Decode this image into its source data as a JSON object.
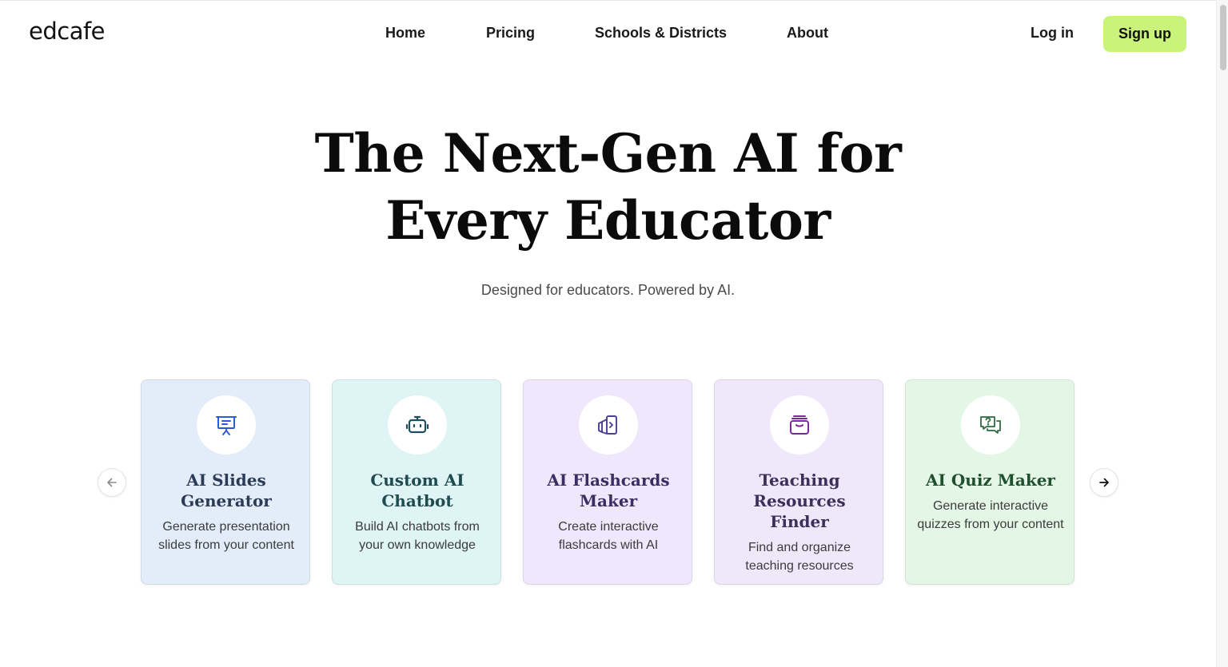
{
  "brand": {
    "logo_text": "edcafe"
  },
  "nav": {
    "items": [
      {
        "label": "Home"
      },
      {
        "label": "Pricing"
      },
      {
        "label": "Schools & Districts"
      },
      {
        "label": "About"
      }
    ],
    "login_label": "Log in",
    "signup_label": "Sign up"
  },
  "hero": {
    "title_line1": "The Next-Gen AI for",
    "title_line2": "Every Educator",
    "subtitle": "Designed for educators. Powered by AI."
  },
  "carousel": {
    "prev_icon": "arrow-left-icon",
    "next_icon": "arrow-right-icon",
    "cards": [
      {
        "title": "AI Slides Generator",
        "description": "Generate presentation slides from your content",
        "icon": "presentation-board-icon",
        "bg_color": "#e3edfa",
        "title_color": "#2b3a55",
        "icon_color": "#2f5bd6"
      },
      {
        "title": "Custom AI Chatbot",
        "description": "Build AI chatbots from your own knowledge",
        "icon": "robot-icon",
        "bg_color": "#def4f5",
        "title_color": "#1f4a4f",
        "icon_color": "#1e4f5a"
      },
      {
        "title": "AI Flashcards Maker",
        "description": "Create interactive flashcards with AI",
        "icon": "flashcards-icon",
        "bg_color": "#efe7fb",
        "title_color": "#3a2f63",
        "icon_color": "#4b3f95"
      },
      {
        "title": "Teaching Resources Finder",
        "description": "Find and organize teaching resources",
        "icon": "archive-box-icon",
        "bg_color": "#efe8fb",
        "title_color": "#3c2f5a",
        "icon_color": "#7a2a9a"
      },
      {
        "title": "AI Quiz Maker",
        "description": "Generate interactive quizzes from your content",
        "icon": "question-chat-icon",
        "bg_color": "#e4f7e6",
        "title_color": "#1f4f2c",
        "icon_color": "#2f6b42"
      }
    ]
  }
}
